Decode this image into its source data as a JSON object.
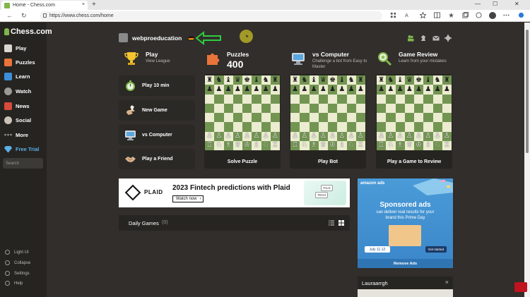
{
  "browser": {
    "tab_title": "Home - Chess.com",
    "tab_close": "×",
    "new_tab": "+",
    "url": "https://www.chess.com/home",
    "back": "←",
    "reload": "↻",
    "minimize": "—",
    "maximize": "☐",
    "close": "✕"
  },
  "sidebar": {
    "logo": "Chess.com",
    "items": [
      {
        "label": "Play"
      },
      {
        "label": "Puzzles"
      },
      {
        "label": "Learn"
      },
      {
        "label": "Watch"
      },
      {
        "label": "News"
      },
      {
        "label": "Social"
      },
      {
        "label": "More"
      },
      {
        "label": "Free Trial"
      }
    ],
    "search_placeholder": "Search",
    "footer": [
      {
        "label": "Light UI"
      },
      {
        "label": "Collapse"
      },
      {
        "label": "Settings"
      },
      {
        "label": "Help"
      }
    ]
  },
  "header": {
    "username": "webproeducation"
  },
  "features": [
    {
      "title": "Play",
      "subtitle": "View League"
    },
    {
      "title": "Puzzles",
      "value": "400"
    },
    {
      "title": "vs Computer",
      "subtitle": "Challenge a bot from Easy to Master"
    },
    {
      "title": "Game Review",
      "subtitle": "Learn from your mistakes"
    }
  ],
  "actions": [
    {
      "label": "Play 10 min"
    },
    {
      "label": "New Game"
    },
    {
      "label": "vs Computer"
    },
    {
      "label": "Play a Friend"
    }
  ],
  "cards": [
    {
      "label": "Solve Puzzle"
    },
    {
      "label": "Play Bot"
    },
    {
      "label": "Play a Game to Review"
    }
  ],
  "ad_plaid": {
    "brand": "PLAID",
    "headline": "2023 Fintech predictions with Plaid",
    "cta": "Watch now",
    "cta_arrow": "›",
    "chip1": "TALK",
    "chip2": "TECH"
  },
  "ad_amazon": {
    "brand": "amazon ads",
    "headline": "Sponsored ads",
    "subtitle": "can deliver real results for your brand this Prime Day",
    "date": "July 11-12",
    "cta": "Get started",
    "remove": "Remove Ads"
  },
  "daily_games": {
    "title": "Daily Games",
    "count": "(0)"
  },
  "chat": {
    "name": "Lauraarrgh",
    "close": "×"
  },
  "colors": {
    "accent_green": "#81b64c",
    "board_light": "#ebecd0",
    "board_dark": "#739552",
    "background": "#312e2b",
    "sidebar": "#262421"
  }
}
